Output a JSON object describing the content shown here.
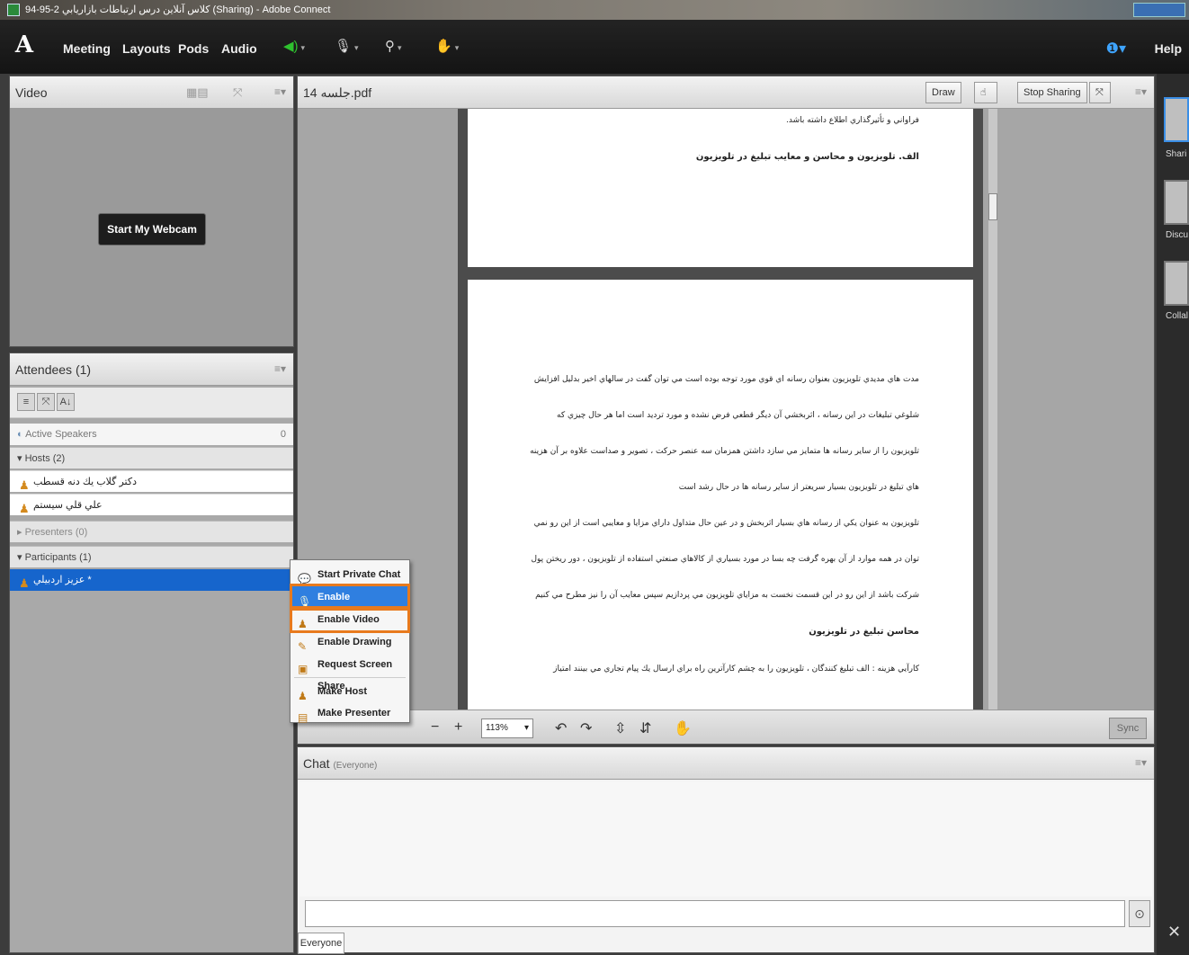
{
  "window": {
    "title": "94-95-2 كلاس آنلاين درس ارتباطات بازاريابي (Sharing) - Adobe Connect"
  },
  "menubar": {
    "items": [
      "Meeting",
      "Layouts",
      "Pods",
      "Audio"
    ],
    "help": "Help"
  },
  "video_pod": {
    "title": "Video",
    "webcam_button": "Start My Webcam"
  },
  "attendees_pod": {
    "title": "Attendees (1)",
    "active_speakers": "Active Speakers",
    "active_speakers_count": "0",
    "groups": {
      "hosts": "Hosts (2)",
      "presenters": "Presenters (0)",
      "participants": "Participants (1)"
    },
    "hosts": [
      "دكتر گلاب يك دنه قسطب",
      "علي قلي سيستم"
    ],
    "participants": [
      "عزيز اردبيلي *"
    ]
  },
  "share_pod": {
    "title": "14 جلسه.pdf",
    "draw_button": "Draw",
    "stop_sharing_button": "Stop Sharing",
    "zoom": "113%",
    "sync_button": "Sync",
    "page1": [
      "فراواني و تأثيرگذاري اطلاع داشته باشد.",
      "الف. تلويزيون و محاسن و معايب تبليغ در تلويزيون"
    ],
    "page2": [
      "مدت هاي مديدي تلويزيون بعنوان رسانه اي قوي مورد توجه بوده است مي توان گفت در سالهاي اخير بدليل افزايش",
      "شلوغي تبليغات در اين رسانه ، اثربخشي آن ديگر قطعي فرض نشده و مورد ترديد است اما هر حال چيزي كه",
      "تلويزيون را از ساير رسانه ها متمايز مي سازد داشتن همزمان سه عنصر حركت ، تصوير و صداست علاوه بر آن هزينه",
      "هاي تبليغ در تلويزيون بسيار سريعتر از ساير      رسانه ها در حال رشد است",
      "تلويزيون به عنوان يكي از رسانه هاي بسيار اثربخش و در عين حال متداول داراي مزايا و معايبي است از اين رو نمي",
      "توان در همه موارد از آن بهره گرفت چه بسا در مورد بسياري از كالاهاي صنعتي استفاده از تلويزيون ، دور ريختن پول",
      "شركت باشد از اين رو در اين قسمت نخست به مزاياي تلويزيون مي پردازيم سپس معايب آن را نيز مطرح مي كنيم",
      "محاسن تبليغ در تلويزيون",
      "كارآيي هزينه : الف تبليغ كنندگان ، تلويزيون را به چشم كارآترين راه براي ارسال يك پيام تجاري مي بينند امتياز"
    ]
  },
  "chat_pod": {
    "title": "Chat",
    "scope": "(Everyone)",
    "tab": "Everyone"
  },
  "rail": {
    "labels": [
      "Shari",
      "Discu",
      "Collal"
    ]
  },
  "context_menu": {
    "items": [
      "Start Private Chat",
      "Enable Microphone",
      "Enable Video",
      "Enable Drawing",
      "Request Screen Share",
      "Make Host",
      "Make Presenter"
    ]
  }
}
